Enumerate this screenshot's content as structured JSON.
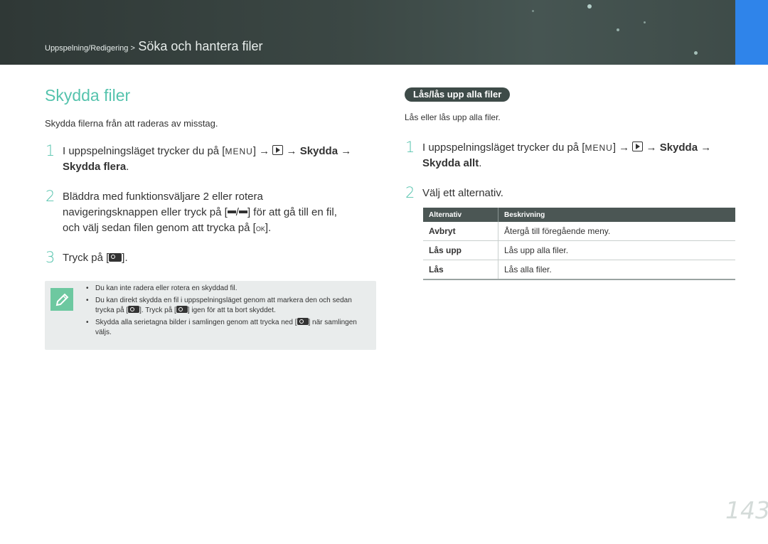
{
  "header": {
    "breadcrumb_parent": "Uppspelning/Redigering >",
    "breadcrumb_current": "Söka och hantera filer"
  },
  "left": {
    "title": "Skydda filer",
    "intro": "Skydda filerna från att raderas av misstag.",
    "steps": [
      {
        "num": "1",
        "pre": "I uppspelningsläget trycker du på [",
        "menu": "MENU",
        "mid": "] → ",
        "arrow": " → ",
        "bold1": "Skydda",
        "arrow2": " →",
        "bold2": "Skydda flera",
        "end": "."
      },
      {
        "num": "2",
        "line1": "Bläddra med funktionsväljare 2 eller rotera",
        "line2_pre": "navigeringsknappen eller tryck på [",
        "sep": "/",
        "line2_post": "] för att gå till en fil,",
        "line3_pre": "och välj sedan filen genom att trycka på [",
        "ok": "OK",
        "line3_post": "]."
      },
      {
        "num": "3",
        "pre": "Tryck på [",
        "post": "]."
      }
    ],
    "notes": [
      "Du kan inte radera eller rotera en skyddad fil.",
      {
        "a": "Du kan direkt skydda en fil i uppspelningsläget genom att markera den och sedan trycka på [",
        "b": "]. Tryck på [",
        "c": "] igen för att ta bort skyddet."
      },
      {
        "a": "Skydda alla serietagna bilder i samlingen genom att trycka ned [",
        "b": "] när samlingen väljs."
      }
    ]
  },
  "right": {
    "section_title": "Lås/lås upp alla filer",
    "intro": "Lås eller lås upp alla filer.",
    "steps": [
      {
        "num": "1",
        "pre": "I uppspelningsläget trycker du på [",
        "menu": "MENU",
        "mid": "] → ",
        "arrow": " → ",
        "bold1": "Skydda",
        "arrow2": " →",
        "bold2": "Skydda allt",
        "end": "."
      },
      {
        "num": "2",
        "text": "Välj ett alternativ."
      }
    ],
    "table": {
      "headers": [
        "Alternativ",
        "Beskrivning"
      ],
      "rows": [
        {
          "option": "Avbryt",
          "description": "Återgå till föregående meny."
        },
        {
          "option": "Lås upp",
          "description": "Lås upp alla filer."
        },
        {
          "option": "Lås",
          "description": "Lås alla filer."
        }
      ]
    }
  },
  "page_number": "143",
  "colors": {
    "accent": "#55c3ad",
    "banner": "#3b4744",
    "tab": "#2f84ea",
    "note_bg": "#e9ecec"
  },
  "icons": [
    "menu-icon",
    "playback-icon",
    "protect-key-icon",
    "navigation-icon",
    "ok-icon",
    "note-pencil-icon"
  ]
}
